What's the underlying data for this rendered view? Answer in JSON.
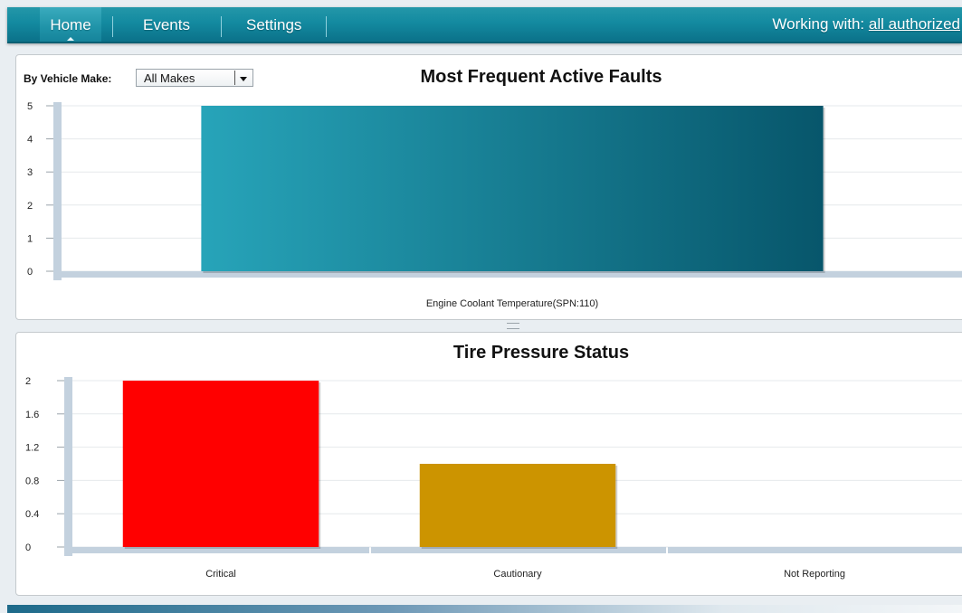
{
  "nav": {
    "tabs": [
      {
        "label": "Home",
        "active": true
      },
      {
        "label": "Events",
        "active": false
      },
      {
        "label": "Settings",
        "active": false
      }
    ],
    "working_prefix": "Working with:",
    "working_link": "all authorized"
  },
  "faults_panel": {
    "filter_label": "By Vehicle Make:",
    "filter_value": "All Makes",
    "title": "Most Frequent Active Faults"
  },
  "tire_panel": {
    "title": "Tire Pressure Status"
  },
  "colors": {
    "nav_bg": "#138aa0",
    "fault_bar_start": "#27a4b9",
    "fault_bar_end": "#07566b",
    "critical": "#ff0000",
    "cautionary": "#cc9400",
    "axis": "#c3d1de"
  },
  "chart_data": [
    {
      "type": "bar",
      "title": "Most Frequent Active Faults",
      "categories": [
        "Engine Coolant Temperature(SPN:110)"
      ],
      "values": [
        5
      ],
      "yticks": [
        "0",
        "1",
        "2",
        "3",
        "4",
        "5"
      ],
      "ylim": [
        0,
        5
      ],
      "grid": true
    },
    {
      "type": "bar",
      "title": "Tire Pressure Status",
      "categories": [
        "Critical",
        "Cautionary",
        "Not Reporting"
      ],
      "values": [
        2,
        1,
        0
      ],
      "yticks": [
        "0",
        "0.4",
        "0.8",
        "1.2",
        "1.6",
        "2"
      ],
      "ylim": [
        0,
        2
      ],
      "grid": true
    }
  ]
}
